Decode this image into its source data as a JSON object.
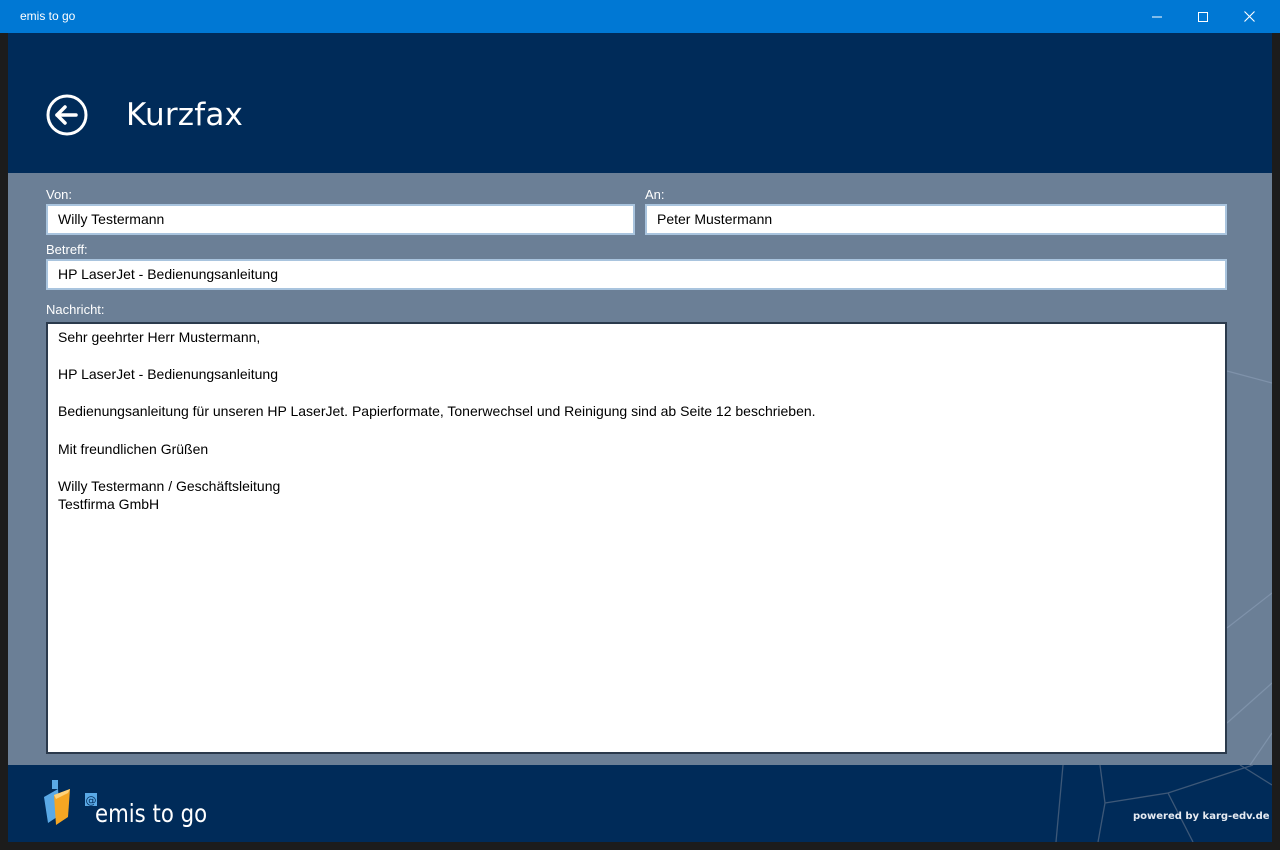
{
  "window": {
    "title": "emis to go"
  },
  "header": {
    "title": "Kurzfax"
  },
  "form": {
    "from_label": "Von:",
    "from_value": "Willy Testermann",
    "to_label": "An:",
    "to_value": "Peter Mustermann",
    "subject_label": "Betreff:",
    "subject_value": "HP LaserJet - Bedienungsanleitung",
    "message_label": "Nachricht:",
    "message_value": "Sehr geehrter Herr Mustermann,\n\nHP LaserJet - Bedienungsanleitung\n\nBedienungsanleitung für unseren HP LaserJet. Papierformate, Tonerwechsel und Reinigung sind ab Seite 12 beschrieben.\n\nMit freundlichen Grüßen\n\nWilly Testermann / Geschäftsleitung\nTestfirma GmbH"
  },
  "footer": {
    "brand": "emis to go",
    "logo_at": "@",
    "powered_by": "powered by karg-edv.de"
  },
  "colors": {
    "titlebar": "#0078d4",
    "header": "#002b59",
    "content": "#6b7f96",
    "field_border": "#a9c4de",
    "logo_blue": "#5aa9e6",
    "logo_orange": "#f5a623"
  },
  "icons": {
    "back": "back-arrow-icon",
    "minimize": "minimize-icon",
    "maximize": "maximize-icon",
    "close": "close-icon",
    "logo": "emis-logo-icon"
  }
}
